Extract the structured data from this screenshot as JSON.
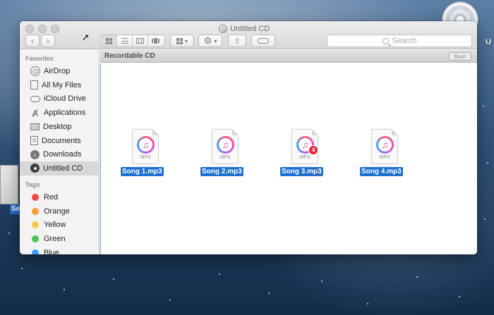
{
  "desktop": {
    "cd_label": "U",
    "file_label": "Se"
  },
  "window": {
    "title": "Untitled CD",
    "search_placeholder": "Search",
    "nav": {
      "back": "‹",
      "forward": "›"
    }
  },
  "sidebar": {
    "favorites_heading": "Favorites",
    "favorites": [
      {
        "label": "AirDrop",
        "icon": "airdrop-icon"
      },
      {
        "label": "All My Files",
        "icon": "all-files-icon"
      },
      {
        "label": "iCloud Drive",
        "icon": "cloud-icon"
      },
      {
        "label": "Applications",
        "icon": "applications-icon"
      },
      {
        "label": "Desktop",
        "icon": "desktop-icon"
      },
      {
        "label": "Documents",
        "icon": "documents-icon"
      },
      {
        "label": "Downloads",
        "icon": "downloads-icon"
      },
      {
        "label": "Untitled CD",
        "icon": "cd-icon",
        "selected": true
      }
    ],
    "tags_heading": "Tags",
    "tags": [
      {
        "label": "Red",
        "color": "#f04848"
      },
      {
        "label": "Orange",
        "color": "#f5a03a"
      },
      {
        "label": "Yellow",
        "color": "#f2c94c"
      },
      {
        "label": "Green",
        "color": "#4cc35a"
      },
      {
        "label": "Blue",
        "color": "#3b9cf3"
      }
    ]
  },
  "pathbar": {
    "label": "Recordable CD",
    "burn_label": "Burn"
  },
  "files": [
    {
      "name": "Song 1.mp3",
      "type_label": "MP3",
      "badge": ""
    },
    {
      "name": "Song 2.mp3",
      "type_label": "MP3",
      "badge": ""
    },
    {
      "name": "Song 3.mp3",
      "type_label": "MP3",
      "badge": "4"
    },
    {
      "name": "Song 4.mp3",
      "type_label": "MP3",
      "badge": ""
    }
  ],
  "colors": {
    "selection": "#1d6fd0",
    "sidebar_bg": "#f3f3f3"
  }
}
